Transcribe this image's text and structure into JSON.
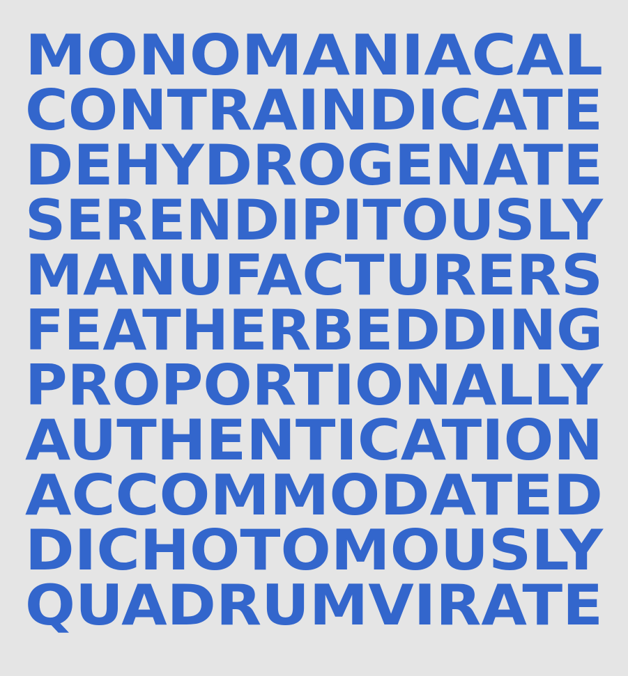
{
  "colors": {
    "background": "#e5e5e5",
    "text": "#3366cc"
  },
  "words": [
    "MONOMANIACAL",
    "CONTRAINDICATE",
    "DEHYDROGENATE",
    "SERENDIPITOUSLY",
    "MANUFACTURERS",
    "FEATHERBEDDING",
    "PROPORTIONALLY",
    "AUTHENTICATION",
    "ACCOMMODATED",
    "DICHOTOMOUSLY",
    "QUADRUMVIRATE"
  ]
}
